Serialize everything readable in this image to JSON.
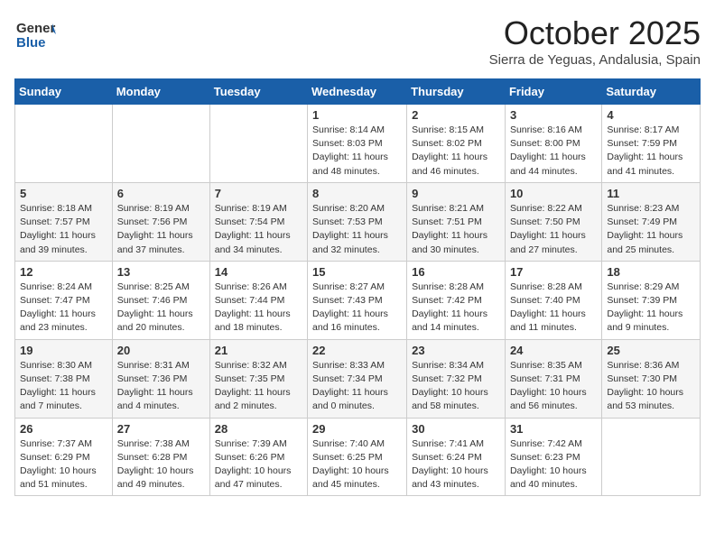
{
  "header": {
    "logo_general": "General",
    "logo_blue": "Blue",
    "month_title": "October 2025",
    "location": "Sierra de Yeguas, Andalusia, Spain"
  },
  "weekdays": [
    "Sunday",
    "Monday",
    "Tuesday",
    "Wednesday",
    "Thursday",
    "Friday",
    "Saturday"
  ],
  "weeks": [
    [
      {
        "day": "",
        "info": ""
      },
      {
        "day": "",
        "info": ""
      },
      {
        "day": "",
        "info": ""
      },
      {
        "day": "1",
        "info": "Sunrise: 8:14 AM\nSunset: 8:03 PM\nDaylight: 11 hours\nand 48 minutes."
      },
      {
        "day": "2",
        "info": "Sunrise: 8:15 AM\nSunset: 8:02 PM\nDaylight: 11 hours\nand 46 minutes."
      },
      {
        "day": "3",
        "info": "Sunrise: 8:16 AM\nSunset: 8:00 PM\nDaylight: 11 hours\nand 44 minutes."
      },
      {
        "day": "4",
        "info": "Sunrise: 8:17 AM\nSunset: 7:59 PM\nDaylight: 11 hours\nand 41 minutes."
      }
    ],
    [
      {
        "day": "5",
        "info": "Sunrise: 8:18 AM\nSunset: 7:57 PM\nDaylight: 11 hours\nand 39 minutes."
      },
      {
        "day": "6",
        "info": "Sunrise: 8:19 AM\nSunset: 7:56 PM\nDaylight: 11 hours\nand 37 minutes."
      },
      {
        "day": "7",
        "info": "Sunrise: 8:19 AM\nSunset: 7:54 PM\nDaylight: 11 hours\nand 34 minutes."
      },
      {
        "day": "8",
        "info": "Sunrise: 8:20 AM\nSunset: 7:53 PM\nDaylight: 11 hours\nand 32 minutes."
      },
      {
        "day": "9",
        "info": "Sunrise: 8:21 AM\nSunset: 7:51 PM\nDaylight: 11 hours\nand 30 minutes."
      },
      {
        "day": "10",
        "info": "Sunrise: 8:22 AM\nSunset: 7:50 PM\nDaylight: 11 hours\nand 27 minutes."
      },
      {
        "day": "11",
        "info": "Sunrise: 8:23 AM\nSunset: 7:49 PM\nDaylight: 11 hours\nand 25 minutes."
      }
    ],
    [
      {
        "day": "12",
        "info": "Sunrise: 8:24 AM\nSunset: 7:47 PM\nDaylight: 11 hours\nand 23 minutes."
      },
      {
        "day": "13",
        "info": "Sunrise: 8:25 AM\nSunset: 7:46 PM\nDaylight: 11 hours\nand 20 minutes."
      },
      {
        "day": "14",
        "info": "Sunrise: 8:26 AM\nSunset: 7:44 PM\nDaylight: 11 hours\nand 18 minutes."
      },
      {
        "day": "15",
        "info": "Sunrise: 8:27 AM\nSunset: 7:43 PM\nDaylight: 11 hours\nand 16 minutes."
      },
      {
        "day": "16",
        "info": "Sunrise: 8:28 AM\nSunset: 7:42 PM\nDaylight: 11 hours\nand 14 minutes."
      },
      {
        "day": "17",
        "info": "Sunrise: 8:28 AM\nSunset: 7:40 PM\nDaylight: 11 hours\nand 11 minutes."
      },
      {
        "day": "18",
        "info": "Sunrise: 8:29 AM\nSunset: 7:39 PM\nDaylight: 11 hours\nand 9 minutes."
      }
    ],
    [
      {
        "day": "19",
        "info": "Sunrise: 8:30 AM\nSunset: 7:38 PM\nDaylight: 11 hours\nand 7 minutes."
      },
      {
        "day": "20",
        "info": "Sunrise: 8:31 AM\nSunset: 7:36 PM\nDaylight: 11 hours\nand 4 minutes."
      },
      {
        "day": "21",
        "info": "Sunrise: 8:32 AM\nSunset: 7:35 PM\nDaylight: 11 hours\nand 2 minutes."
      },
      {
        "day": "22",
        "info": "Sunrise: 8:33 AM\nSunset: 7:34 PM\nDaylight: 11 hours\nand 0 minutes."
      },
      {
        "day": "23",
        "info": "Sunrise: 8:34 AM\nSunset: 7:32 PM\nDaylight: 10 hours\nand 58 minutes."
      },
      {
        "day": "24",
        "info": "Sunrise: 8:35 AM\nSunset: 7:31 PM\nDaylight: 10 hours\nand 56 minutes."
      },
      {
        "day": "25",
        "info": "Sunrise: 8:36 AM\nSunset: 7:30 PM\nDaylight: 10 hours\nand 53 minutes."
      }
    ],
    [
      {
        "day": "26",
        "info": "Sunrise: 7:37 AM\nSunset: 6:29 PM\nDaylight: 10 hours\nand 51 minutes."
      },
      {
        "day": "27",
        "info": "Sunrise: 7:38 AM\nSunset: 6:28 PM\nDaylight: 10 hours\nand 49 minutes."
      },
      {
        "day": "28",
        "info": "Sunrise: 7:39 AM\nSunset: 6:26 PM\nDaylight: 10 hours\nand 47 minutes."
      },
      {
        "day": "29",
        "info": "Sunrise: 7:40 AM\nSunset: 6:25 PM\nDaylight: 10 hours\nand 45 minutes."
      },
      {
        "day": "30",
        "info": "Sunrise: 7:41 AM\nSunset: 6:24 PM\nDaylight: 10 hours\nand 43 minutes."
      },
      {
        "day": "31",
        "info": "Sunrise: 7:42 AM\nSunset: 6:23 PM\nDaylight: 10 hours\nand 40 minutes."
      },
      {
        "day": "",
        "info": ""
      }
    ]
  ]
}
